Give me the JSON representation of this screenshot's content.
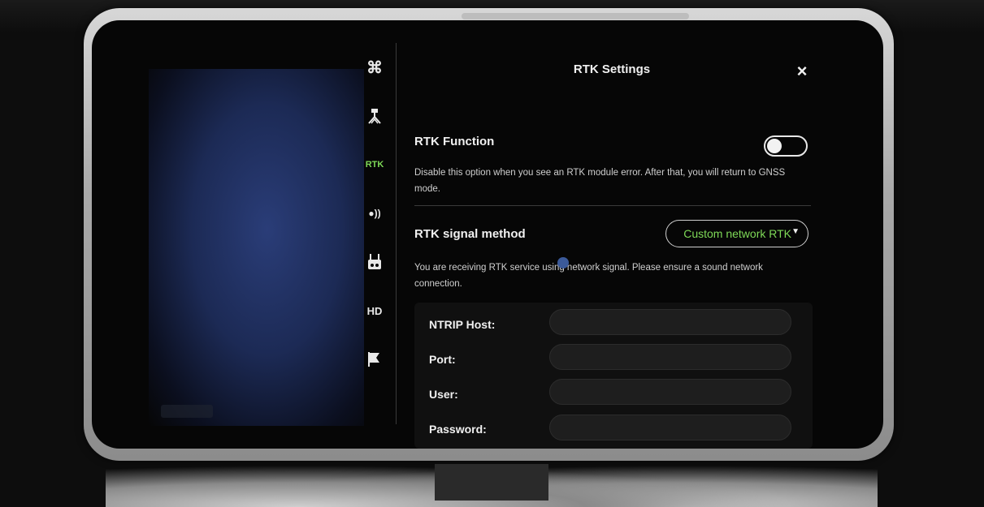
{
  "menu": {
    "items": [
      {
        "name": "aircraft",
        "icon": "drone-icon",
        "label": "⌘"
      },
      {
        "name": "satellite",
        "icon": "satellite-icon",
        "label": ""
      },
      {
        "name": "rtk",
        "icon": "",
        "label": "RTK"
      },
      {
        "name": "transmission",
        "icon": "signal-icon",
        "label": "●))"
      },
      {
        "name": "remote",
        "icon": "remote-controller-icon",
        "label": ""
      },
      {
        "name": "hd",
        "icon": "",
        "label": "HD"
      },
      {
        "name": "more",
        "icon": "flag-icon",
        "label": ""
      }
    ],
    "active": "RTK",
    "active_color": "#7ed957"
  },
  "panel": {
    "title": "RTK Settings",
    "close_label": "×",
    "rtk_function": {
      "label": "RTK Function",
      "enabled": false,
      "description": "Disable this option when you see an RTK module error. After that, you will return to GNSS mode."
    },
    "signal_method": {
      "label": "RTK signal method",
      "selected": "Custom network RTK",
      "description": "You are receiving RTK service using network signal. Please ensure a sound network connection."
    },
    "form": {
      "fields": [
        {
          "label": "NTRIP Host:",
          "value": ""
        },
        {
          "label": "Port:",
          "value": ""
        },
        {
          "label": "User:",
          "value": ""
        },
        {
          "label": "Password:",
          "value": ""
        }
      ]
    }
  },
  "colors": {
    "accent": "#7ed957",
    "background": "#060606",
    "frame": "#a9a9a9"
  }
}
